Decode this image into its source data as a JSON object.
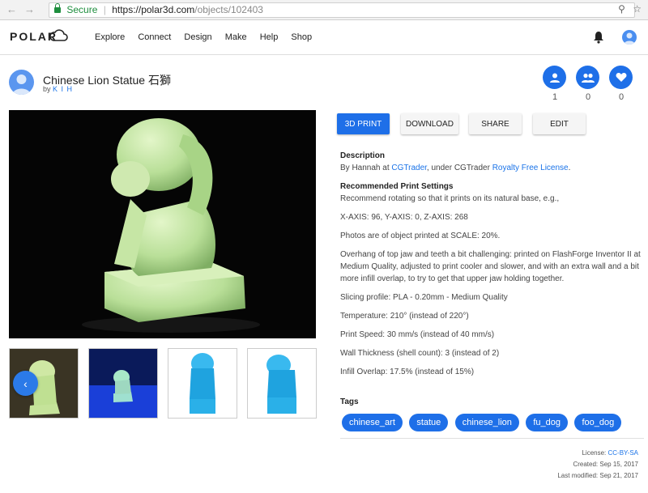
{
  "browser": {
    "secure_label": "Secure",
    "url_host": "https://polar3d.com",
    "url_path": "/objects/102403"
  },
  "nav": {
    "logo": "POLAR",
    "items": [
      "Explore",
      "Connect",
      "Design",
      "Make",
      "Help",
      "Shop"
    ]
  },
  "object": {
    "title": "Chinese Lion Statue 石獅",
    "by_label": "by",
    "author": "K I H"
  },
  "stats": {
    "followers": "1",
    "collaborators": "0",
    "likes": "0"
  },
  "actions": {
    "print": "3D PRINT",
    "download": "DOWNLOAD",
    "share": "SHARE",
    "edit": "EDIT"
  },
  "description": {
    "heading": "Description",
    "line1_pre": "By Hannah at ",
    "line1_link1": "CGTrader",
    "line1_mid": ", under CGTrader ",
    "line1_link2": "Royalty Free License",
    "line1_post": ".",
    "settings_heading": "Recommended Print Settings",
    "settings_intro": "Recommend rotating so that it prints on its natural base, e.g.,",
    "axes": "X-AXIS: 96, Y-AXIS: 0, Z-AXIS: 268",
    "scale": "Photos are of object printed at SCALE: 20%.",
    "overhang": "Overhang of top jaw and teeth a bit challenging: printed on FlashForge Inventor II at Medium Quality, adjusted to print cooler and slower, and with an extra wall and a bit more infill overlap, to try to get that upper jaw holding together.",
    "slicing": "Slicing profile: PLA - 0.20mm - Medium Quality",
    "temperature": "Temperature: 210° (instead of 220°)",
    "speed": "Print Speed: 30 mm/s (instead of 40 mm/s)",
    "wall": "Wall Thickness (shell count): 3 (instead of 2)",
    "infill": "Infill Overlap: 17.5% (instead of 15%)"
  },
  "tags": {
    "heading": "Tags",
    "items": [
      "chinese_art",
      "statue",
      "chinese_lion",
      "fu_dog",
      "foo_dog"
    ]
  },
  "meta": {
    "license_label": "License:",
    "license": "CC-BY-SA",
    "created_label": "Created:",
    "created": "Sep 15, 2017",
    "modified_label": "Last modified:",
    "modified": "Sep 21, 2017"
  }
}
